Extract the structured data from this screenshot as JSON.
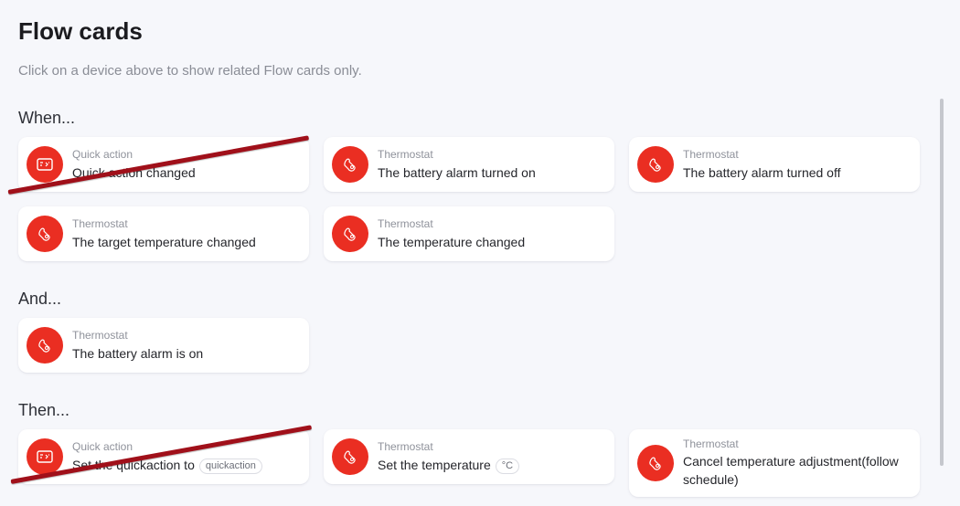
{
  "page": {
    "title": "Flow cards",
    "subtitle": "Click on a device above to show related Flow cards only."
  },
  "sections": {
    "when": {
      "title": "When...",
      "cards": [
        {
          "kind": "Quick action",
          "label": "Quick action changed",
          "icon": "quick-action-icon"
        },
        {
          "kind": "Thermostat",
          "label": "The battery alarm turned on",
          "icon": "thermostat-icon"
        },
        {
          "kind": "Thermostat",
          "label": "The battery alarm turned off",
          "icon": "thermostat-icon"
        },
        {
          "kind": "Thermostat",
          "label": "The target temperature changed",
          "icon": "thermostat-icon"
        },
        {
          "kind": "Thermostat",
          "label": "The temperature changed",
          "icon": "thermostat-icon"
        }
      ]
    },
    "and": {
      "title": "And...",
      "cards": [
        {
          "kind": "Thermostat",
          "label": "The battery alarm is on",
          "icon": "thermostat-icon"
        }
      ]
    },
    "then": {
      "title": "Then...",
      "cards": [
        {
          "kind": "Quick action",
          "label": "Set the quickaction to",
          "token": "quickaction",
          "icon": "quick-action-icon"
        },
        {
          "kind": "Thermostat",
          "label": "Set the temperature",
          "token": "°C",
          "icon": "thermostat-icon"
        },
        {
          "kind": "Thermostat",
          "label": "Cancel temperature adjustment(follow schedule)",
          "icon": "thermostat-icon"
        }
      ]
    }
  },
  "colors": {
    "background": "#f6f7fb",
    "icon_background": "#ea2e22",
    "strike_line": "#a0101a"
  }
}
